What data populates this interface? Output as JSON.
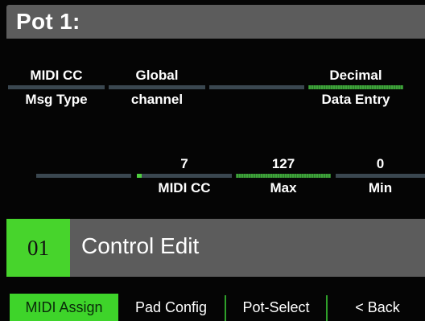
{
  "title": "Pot 1:",
  "row1": [
    {
      "value": "MIDI CC",
      "label": "Msg Type",
      "active": false
    },
    {
      "value": "Global",
      "label": "channel",
      "active": false
    },
    {
      "value": "",
      "label": "",
      "active": false
    },
    {
      "value": "Decimal",
      "label": "Data Entry",
      "active": true
    }
  ],
  "row2": [
    {
      "value": "",
      "label": "",
      "active": false
    },
    {
      "value": "7",
      "label": "MIDI CC",
      "active": false
    },
    {
      "value": "127",
      "label": "Max",
      "active": true
    },
    {
      "value": "0",
      "label": "Min",
      "active": false
    }
  ],
  "panel": {
    "number": "01",
    "title": "Control Edit"
  },
  "softkeys": [
    {
      "label": "MIDI Assign",
      "active": true
    },
    {
      "label": "Pad Config",
      "active": false
    },
    {
      "label": "Pot-Select",
      "active": false
    },
    {
      "label": "< Back",
      "active": false
    }
  ],
  "colors": {
    "accent": "#3ed42a",
    "panel": "#5c5c5c",
    "bar_inactive": "#3a4750",
    "background": "#050505"
  }
}
